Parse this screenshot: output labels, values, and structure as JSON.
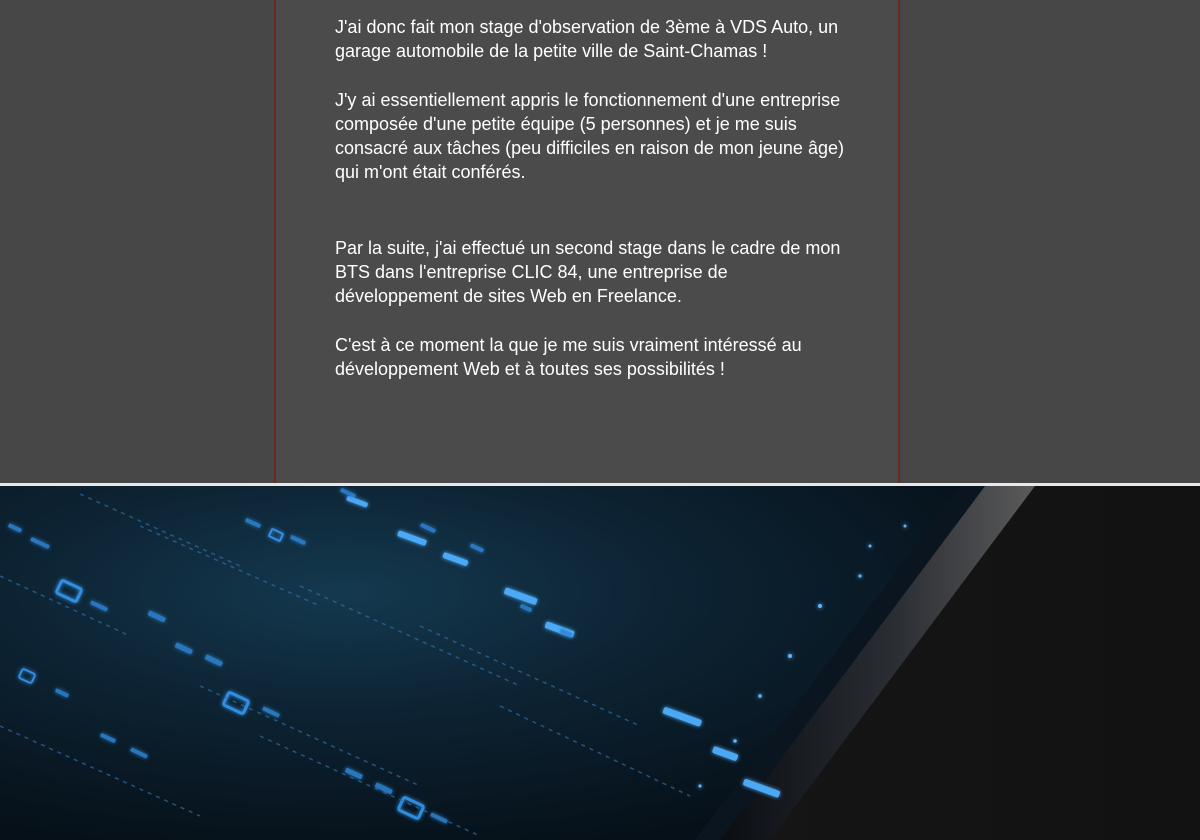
{
  "article": {
    "paragraphs": [
      "J'ai donc fait mon stage d'observation de 3ème à VDS Auto, un garage automobile de la petite ville de Saint-Chamas !",
      "J'y ai essentiellement appris le fonctionnement d'une entreprise composée d'une petite équipe (5 personnes) et je me suis consacré aux tâches (peu difficiles en raison de mon jeune âge) qui m'ont était conférés.",
      "Par la suite, j'ai effectué un second stage dans le cadre de mon BTS dans l'entreprise CLIC 84, une entreprise de développement de sites Web en Freelance.",
      "C'est à ce moment la que je me suis vraiment intéressé au développement Web et à toutes ses possibilités !"
    ]
  },
  "theme": {
    "page_bg": "#474747",
    "column_bg": "#4b4b4b",
    "column_border": "#6a2a1c",
    "text_color": "#ffffff",
    "divider_color": "#e8e8e8",
    "banner_glow": "#3a8cff"
  },
  "banner": {
    "icon": "digital-data-stream-image"
  }
}
